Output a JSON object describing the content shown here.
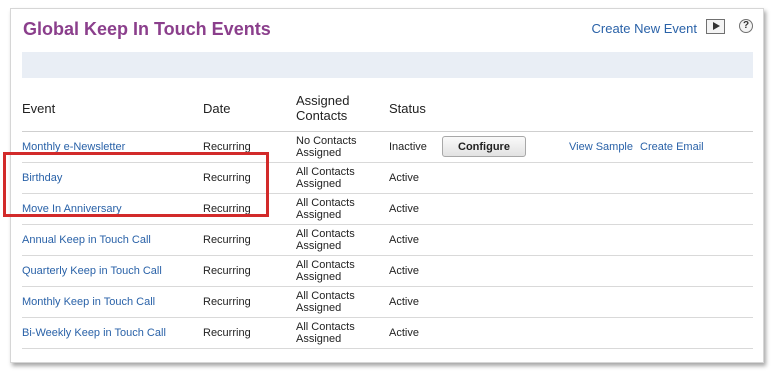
{
  "title": "Global Keep In Touch Events",
  "header_links": {
    "create_new": "Create New Event",
    "help": "?"
  },
  "columns": {
    "event": "Event",
    "date": "Date",
    "assigned_line1": "Assigned",
    "assigned_line2": "Contacts",
    "status": "Status"
  },
  "rows": [
    {
      "event": "Monthly e-Newsletter",
      "date": "Recurring",
      "assigned1": "No Contacts",
      "assigned2": "Assigned",
      "status": "Inactive",
      "configure": "Configure",
      "view_sample": "View Sample",
      "create_email": "Create Email"
    },
    {
      "event": "Birthday",
      "date": "Recurring",
      "assigned1": "All Contacts",
      "assigned2": "Assigned",
      "status": "Active"
    },
    {
      "event": "Move In Anniversary",
      "date": "Recurring",
      "assigned1": "All Contacts",
      "assigned2": "Assigned",
      "status": "Active"
    },
    {
      "event": "Annual Keep in Touch Call",
      "date": "Recurring",
      "assigned1": "All Contacts",
      "assigned2": "Assigned",
      "status": "Active"
    },
    {
      "event": "Quarterly Keep in Touch Call",
      "date": "Recurring",
      "assigned1": "All Contacts",
      "assigned2": "Assigned",
      "status": "Active"
    },
    {
      "event": "Monthly Keep in Touch Call",
      "date": "Recurring",
      "assigned1": "All Contacts",
      "assigned2": "Assigned",
      "status": "Active"
    },
    {
      "event": "Bi-Weekly Keep in Touch Call",
      "date": "Recurring",
      "assigned1": "All Contacts",
      "assigned2": "Assigned",
      "status": "Active"
    }
  ],
  "colors": {
    "title": "#8b3f8c",
    "link": "#2a62a8",
    "highlight": "#d22a2a",
    "band": "#e9eef5"
  }
}
